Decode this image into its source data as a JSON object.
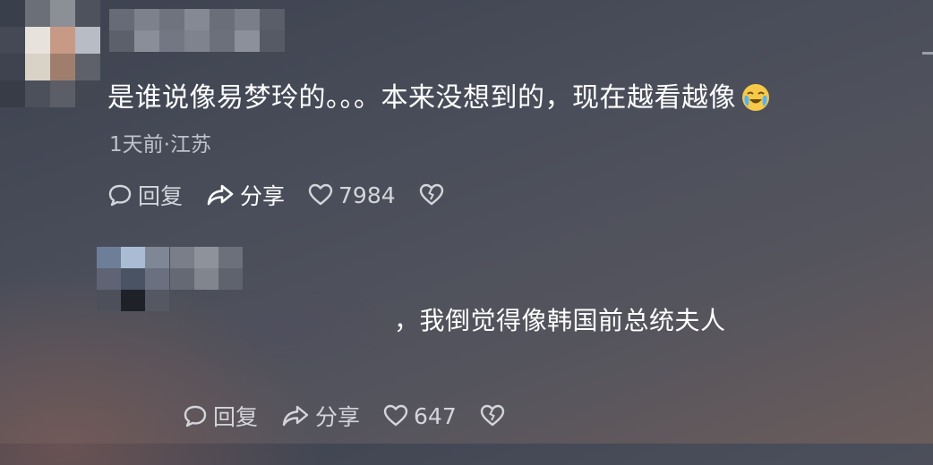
{
  "comments": [
    {
      "text": "是谁说像易梦玲的。。。本来没想到的，现在越看越像",
      "emoji": "crying-laughing-emoji",
      "meta": "1天前·江苏",
      "reply_label": "回复",
      "share_label": "分享",
      "like_count": "7984"
    },
    {
      "text": "，我倒觉得像韩国前总统夫人",
      "reply_label": "回复",
      "share_label": "分享",
      "like_count": "647"
    }
  ],
  "colors": {
    "background": "#4a4e5a",
    "text": "#ffffff",
    "meta": "#bfc2c9",
    "action": "#d3d5da"
  },
  "icons": [
    "reply-icon",
    "share-icon",
    "heart-icon",
    "dislike-icon"
  ]
}
